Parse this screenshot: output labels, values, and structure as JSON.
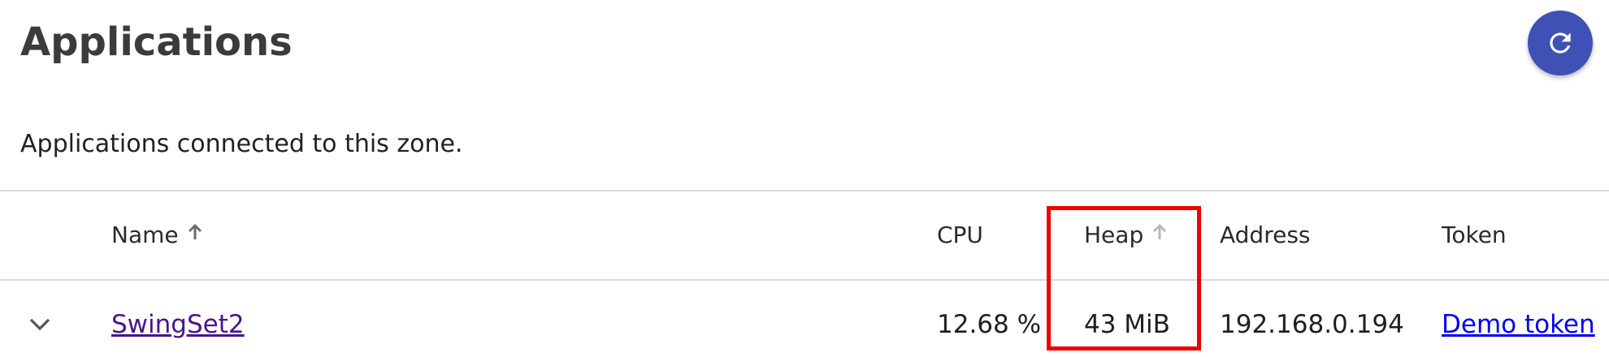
{
  "header": {
    "title": "Applications",
    "subtitle": "Applications connected to this zone."
  },
  "icons": {
    "refresh": "refresh-icon",
    "sort_name": "arrow-up-icon",
    "sort_heap": "arrow-up-icon",
    "expand": "chevron-down-icon"
  },
  "colors": {
    "accent": "#3f51b5",
    "visited_link": "#4a148c",
    "link": "#0000ee",
    "highlight": "#ee0000"
  },
  "table": {
    "columns": {
      "name": "Name",
      "cpu": "CPU",
      "heap": "Heap",
      "address": "Address",
      "token": "Token"
    },
    "sort": {
      "active_column": "name",
      "direction": "ascending"
    },
    "rows": [
      {
        "name": "SwingSet2",
        "cpu": "12.68 %",
        "heap": "43 MiB",
        "address": "192.168.0.194",
        "token": "Demo token"
      }
    ]
  }
}
